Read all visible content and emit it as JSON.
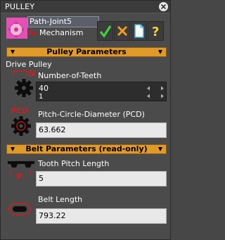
{
  "window": {
    "title": "PULLEY"
  },
  "header": {
    "component_name": "Path-Joint5",
    "mechanism_name": "Mechanism"
  },
  "buttons": {
    "ok": "✓",
    "cancel": "✗",
    "new": "new-document",
    "help": "?"
  },
  "pulley_section": {
    "title": "Pulley Parameters",
    "subheading": "Drive Pulley",
    "teeth_label": "Number-of-Teeth",
    "teeth_value": "40",
    "teeth_min": "1",
    "pcd_label": "Pitch-Circle-Diameter (PCD)",
    "pcd_value": "63.662",
    "teeth_icon_letter": "N",
    "pcd_icon_text": "PCD"
  },
  "belt_section": {
    "title": "Belt Parameters (read-only)",
    "pitch_label": "Tooth Pitch Length",
    "pitch_value": "5",
    "pitch_icon_letter": "P",
    "length_label": "Belt Length",
    "length_value": "793.22"
  },
  "colors": {
    "section_bg": "#e09a2a",
    "ok_green": "#3fd13f",
    "cancel_orange": "#f0a020",
    "help_yellow": "#f0d040",
    "accent_red": "#cc1f1f"
  }
}
